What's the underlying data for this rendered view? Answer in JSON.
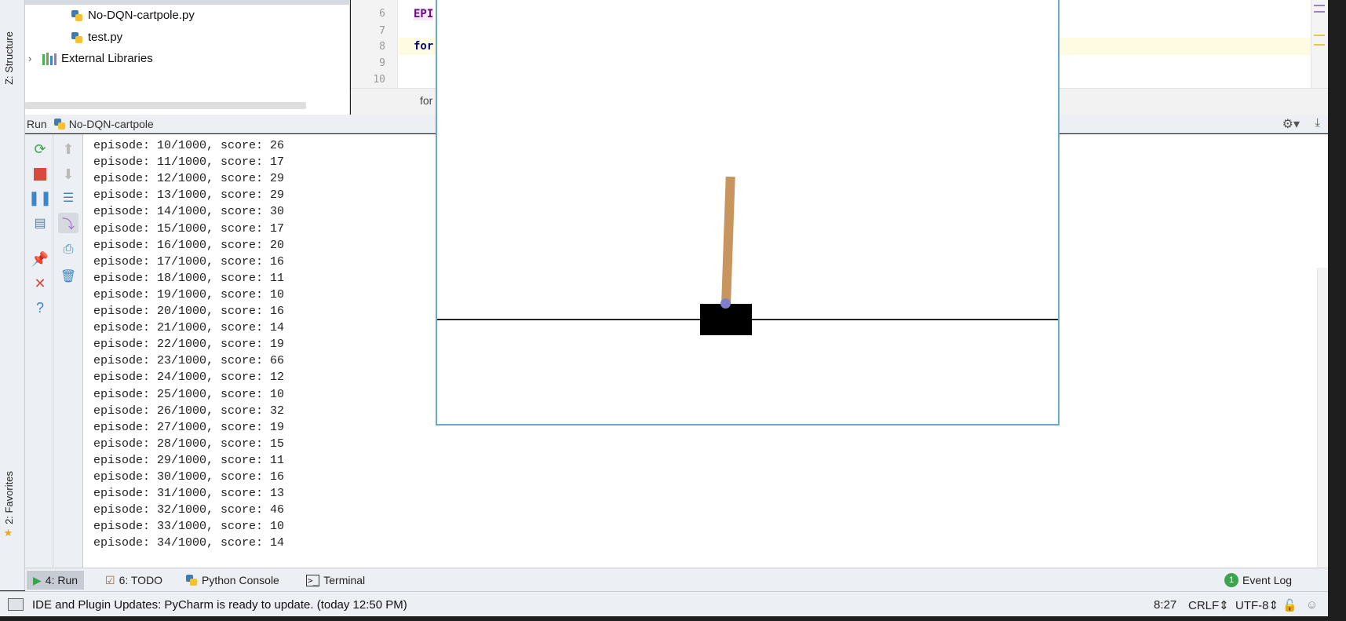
{
  "left_strip": {
    "structure_label": "Z: Structure",
    "favorites_label": "2: Favorites"
  },
  "project_tree": {
    "items": [
      {
        "label": "No-DQN-cartpole.py",
        "icon": "python-file-icon"
      },
      {
        "label": "test.py",
        "icon": "python-file-icon"
      },
      {
        "label": "External Libraries",
        "icon": "library-icon"
      }
    ]
  },
  "editor": {
    "line_numbers": [
      "6",
      "7",
      "8",
      "9",
      "10"
    ],
    "visible_code": {
      "line6": "EPI",
      "line8": "for"
    },
    "breadcrumb": "for"
  },
  "run_panel": {
    "title": "Run",
    "config_name": "No-DQN-cartpole",
    "console_lines": [
      "episode: 10/1000, score: 26",
      "episode: 11/1000, score: 17",
      "episode: 12/1000, score: 29",
      "episode: 13/1000, score: 29",
      "episode: 14/1000, score: 30",
      "episode: 15/1000, score: 17",
      "episode: 16/1000, score: 20",
      "episode: 17/1000, score: 16",
      "episode: 18/1000, score: 11",
      "episode: 19/1000, score: 10",
      "episode: 20/1000, score: 16",
      "episode: 21/1000, score: 14",
      "episode: 22/1000, score: 19",
      "episode: 23/1000, score: 66",
      "episode: 24/1000, score: 12",
      "episode: 25/1000, score: 10",
      "episode: 26/1000, score: 32",
      "episode: 27/1000, score: 19",
      "episode: 28/1000, score: 15",
      "episode: 29/1000, score: 11",
      "episode: 30/1000, score: 16",
      "episode: 31/1000, score: 13",
      "episode: 32/1000, score: 46",
      "episode: 33/1000, score: 10",
      "episode: 34/1000, score: 14"
    ]
  },
  "gym_render": {
    "pole_color": "#c9955e",
    "cart_color": "#000000",
    "axle_color": "#7f7fcc",
    "pole_angle_deg": 2
  },
  "tool_windows": {
    "run": "4: Run",
    "todo": "6: TODO",
    "python_console": "Python Console",
    "terminal": "Terminal",
    "event_log": "Event Log",
    "event_log_count": "1"
  },
  "status_bar": {
    "message": "IDE and Plugin Updates: PyCharm is ready to update. (today 12:50 PM)",
    "position": "8:27",
    "line_separator": "CRLF",
    "encoding": "UTF-8"
  },
  "colors": {
    "accent": "#3fa34d",
    "ide_chrome": "#eceff3"
  }
}
